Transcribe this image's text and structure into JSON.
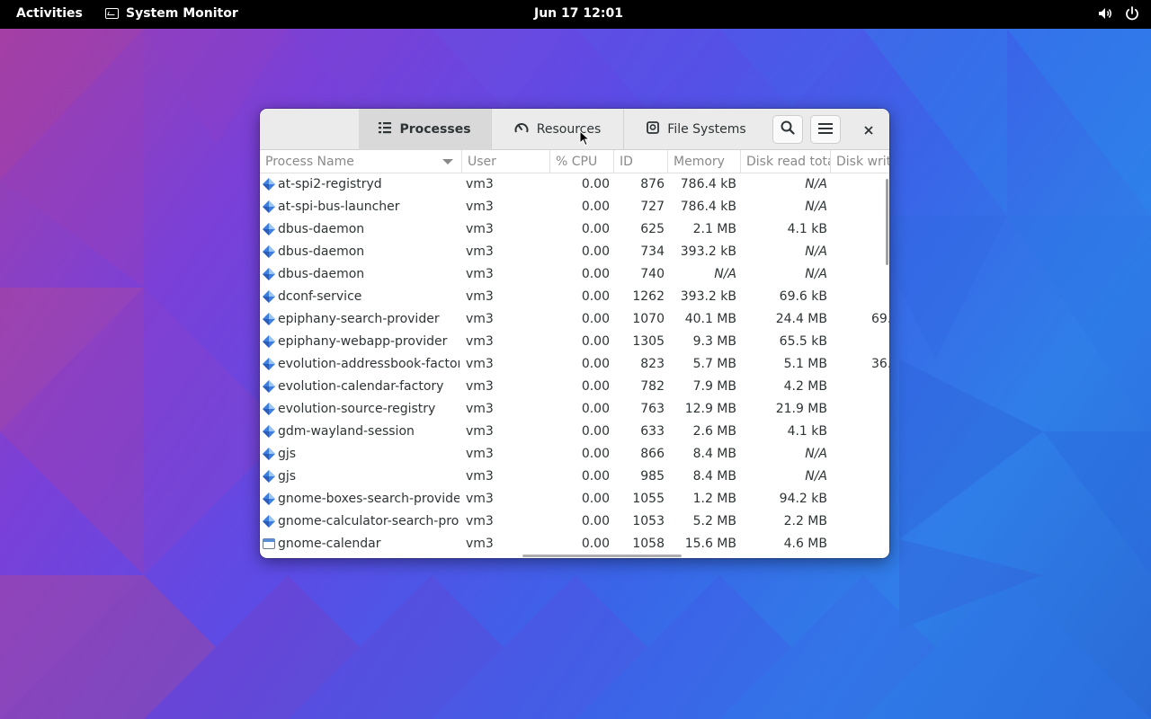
{
  "topbar": {
    "activities": "Activities",
    "app_name": "System Monitor",
    "clock": "Jun 17  12:01",
    "icons": [
      "volume-icon",
      "power-icon"
    ]
  },
  "window": {
    "tabs": [
      {
        "label": "Processes",
        "icon": "list-icon",
        "active": true
      },
      {
        "label": "Resources",
        "icon": "gauge-icon",
        "active": false
      },
      {
        "label": "File Systems",
        "icon": "disk-icon",
        "active": false
      }
    ],
    "buttons": [
      "search-icon",
      "menu-icon",
      "close-icon"
    ],
    "columns": [
      "Process Name",
      "User",
      "% CPU",
      "ID",
      "Memory",
      "Disk read tota",
      "Disk writ"
    ],
    "rows": [
      {
        "name": "at-spi2-registryd",
        "user": "vm3",
        "cpu": "0.00",
        "id": "876",
        "memory": "786.4 kB",
        "disk_read": "N/A",
        "disk_write": ""
      },
      {
        "name": "at-spi-bus-launcher",
        "user": "vm3",
        "cpu": "0.00",
        "id": "727",
        "memory": "786.4 kB",
        "disk_read": "N/A",
        "disk_write": ""
      },
      {
        "name": "dbus-daemon",
        "user": "vm3",
        "cpu": "0.00",
        "id": "625",
        "memory": "2.1 MB",
        "disk_read": "4.1 kB",
        "disk_write": ""
      },
      {
        "name": "dbus-daemon",
        "user": "vm3",
        "cpu": "0.00",
        "id": "734",
        "memory": "393.2 kB",
        "disk_read": "N/A",
        "disk_write": ""
      },
      {
        "name": "dbus-daemon",
        "user": "vm3",
        "cpu": "0.00",
        "id": "740",
        "memory": "N/A",
        "disk_read": "N/A",
        "disk_write": ""
      },
      {
        "name": "dconf-service",
        "user": "vm3",
        "cpu": "0.00",
        "id": "1262",
        "memory": "393.2 kB",
        "disk_read": "69.6 kB",
        "disk_write": ""
      },
      {
        "name": "epiphany-search-provider",
        "user": "vm3",
        "cpu": "0.00",
        "id": "1070",
        "memory": "40.1 MB",
        "disk_read": "24.4 MB",
        "disk_write": "69."
      },
      {
        "name": "epiphany-webapp-provider",
        "user": "vm3",
        "cpu": "0.00",
        "id": "1305",
        "memory": "9.3 MB",
        "disk_read": "65.5 kB",
        "disk_write": ""
      },
      {
        "name": "evolution-addressbook-factory",
        "user": "vm3",
        "cpu": "0.00",
        "id": "823",
        "memory": "5.7 MB",
        "disk_read": "5.1 MB",
        "disk_write": "36."
      },
      {
        "name": "evolution-calendar-factory",
        "user": "vm3",
        "cpu": "0.00",
        "id": "782",
        "memory": "7.9 MB",
        "disk_read": "4.2 MB",
        "disk_write": ""
      },
      {
        "name": "evolution-source-registry",
        "user": "vm3",
        "cpu": "0.00",
        "id": "763",
        "memory": "12.9 MB",
        "disk_read": "21.9 MB",
        "disk_write": ""
      },
      {
        "name": "gdm-wayland-session",
        "user": "vm3",
        "cpu": "0.00",
        "id": "633",
        "memory": "2.6 MB",
        "disk_read": "4.1 kB",
        "disk_write": ""
      },
      {
        "name": "gjs",
        "user": "vm3",
        "cpu": "0.00",
        "id": "866",
        "memory": "8.4 MB",
        "disk_read": "N/A",
        "disk_write": ""
      },
      {
        "name": "gjs",
        "user": "vm3",
        "cpu": "0.00",
        "id": "985",
        "memory": "8.4 MB",
        "disk_read": "N/A",
        "disk_write": ""
      },
      {
        "name": "gnome-boxes-search-provider",
        "user": "vm3",
        "cpu": "0.00",
        "id": "1055",
        "memory": "1.2 MB",
        "disk_read": "94.2 kB",
        "disk_write": ""
      },
      {
        "name": "gnome-calculator-search-provi",
        "user": "vm3",
        "cpu": "0.00",
        "id": "1053",
        "memory": "5.2 MB",
        "disk_read": "2.2 MB",
        "disk_write": ""
      },
      {
        "name": "gnome-calendar",
        "user": "vm3",
        "cpu": "0.00",
        "id": "1058",
        "memory": "15.6 MB",
        "disk_read": "4.6 MB",
        "disk_write": "",
        "icon": "calendar-app-icon"
      }
    ]
  }
}
